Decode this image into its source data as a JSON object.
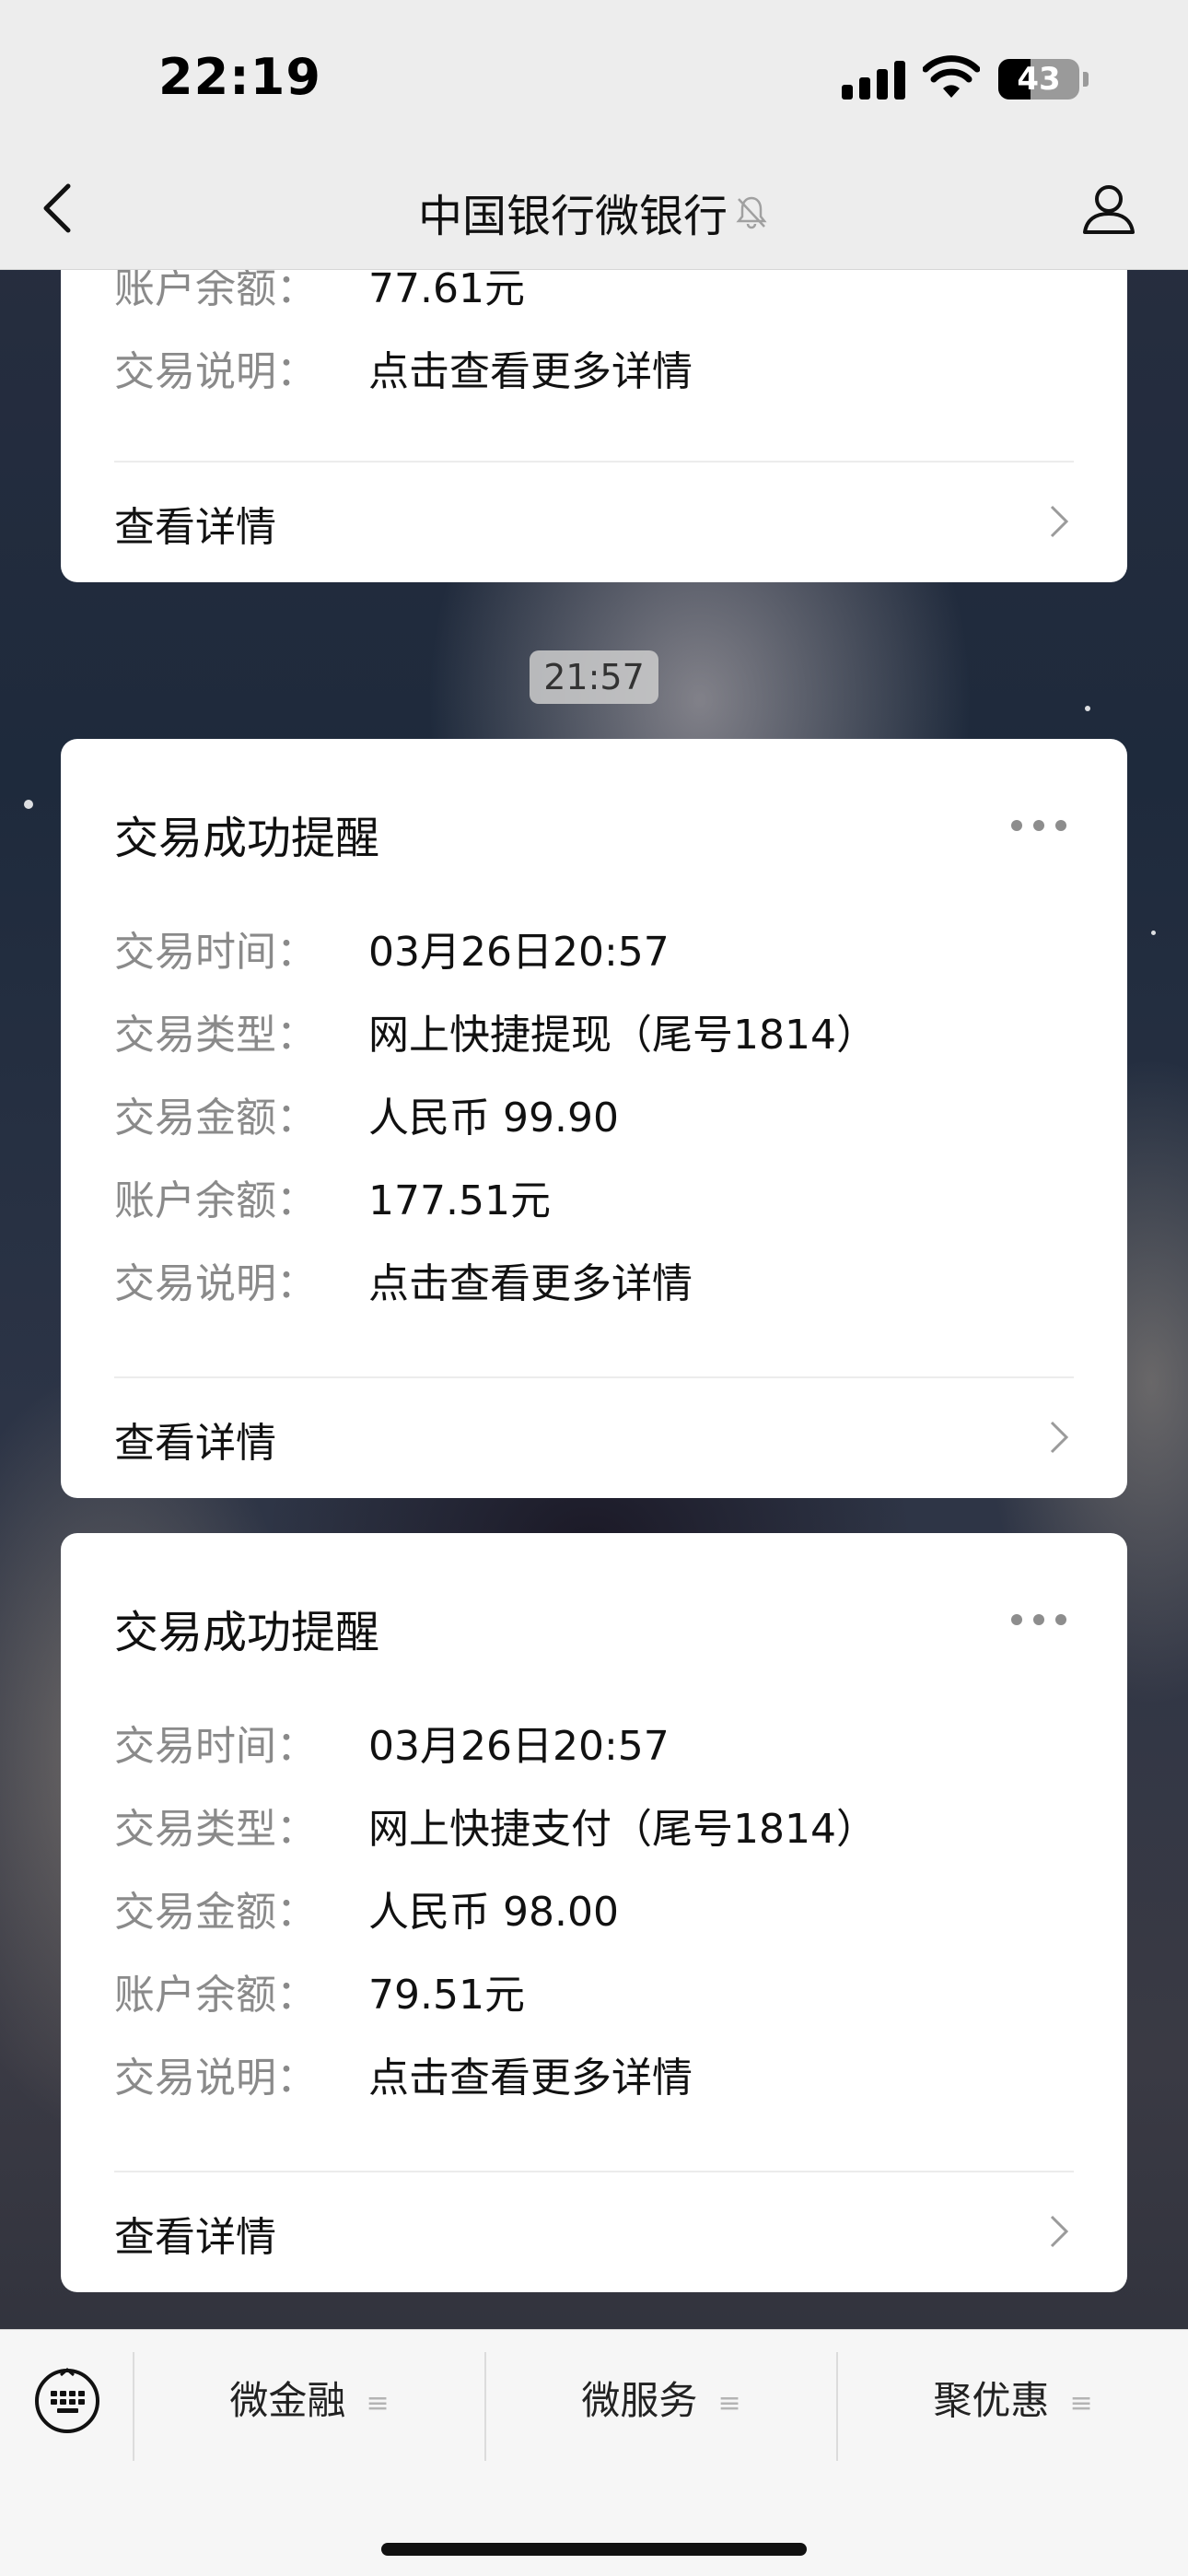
{
  "status_bar": {
    "time": "22:19",
    "battery_level": "43",
    "icons": [
      "cellular-signal-icon",
      "wifi-icon",
      "battery-icon"
    ]
  },
  "nav": {
    "title": "中国银行微银行",
    "back_icon": "chevron-left-icon",
    "mute_icon": "bell-muted-icon",
    "profile_icon": "person-icon"
  },
  "partial_card": {
    "rows": [
      {
        "key": "账户余额：",
        "value": "77.61元"
      },
      {
        "key": "交易说明：",
        "value": "点击查看更多详情"
      }
    ],
    "detail_label": "查看详情"
  },
  "time_divider": "21:57",
  "cards": [
    {
      "title": "交易成功提醒",
      "rows": [
        {
          "key": "交易时间：",
          "value": "03月26日20:57"
        },
        {
          "key": "交易类型：",
          "value": "网上快捷提现（尾号1814）"
        },
        {
          "key": "交易金额：",
          "value": "人民币 99.90"
        },
        {
          "key": "账户余额：",
          "value": "177.51元"
        },
        {
          "key": "交易说明：",
          "value": "点击查看更多详情"
        }
      ],
      "detail_label": "查看详情"
    },
    {
      "title": "交易成功提醒",
      "rows": [
        {
          "key": "交易时间：",
          "value": "03月26日20:57"
        },
        {
          "key": "交易类型：",
          "value": "网上快捷支付（尾号1814）"
        },
        {
          "key": "交易金额：",
          "value": "人民币 98.00"
        },
        {
          "key": "账户余额：",
          "value": "79.51元"
        },
        {
          "key": "交易说明：",
          "value": "点击查看更多详情"
        }
      ],
      "detail_label": "查看详情"
    }
  ],
  "bottom_menu": {
    "keyboard_icon": "keyboard-icon",
    "items": [
      {
        "label": "微金融",
        "icon": "menu-lines-icon"
      },
      {
        "label": "微服务",
        "icon": "menu-lines-icon"
      },
      {
        "label": "聚优惠",
        "icon": "menu-lines-icon"
      }
    ]
  }
}
